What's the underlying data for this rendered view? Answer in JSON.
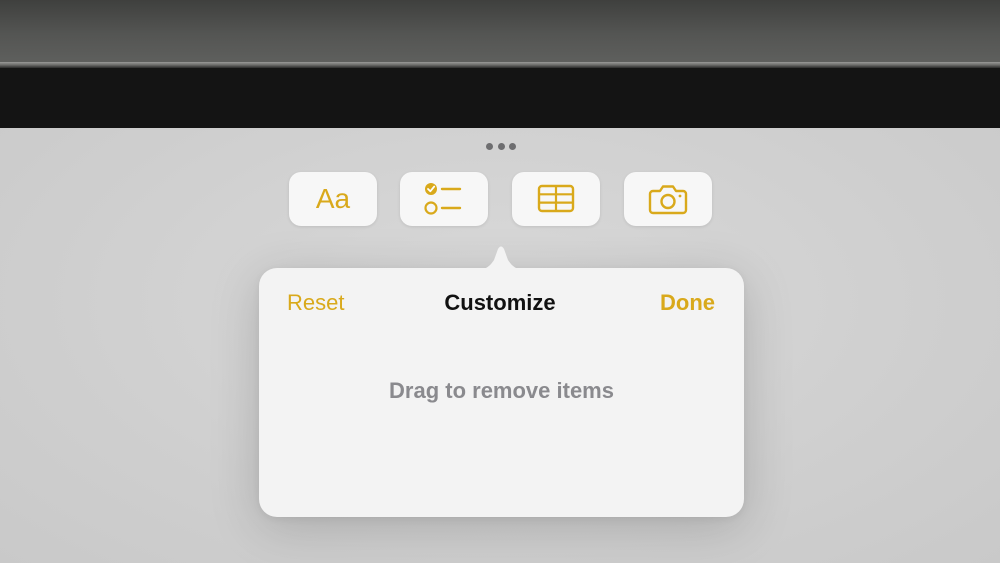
{
  "colors": {
    "accent": "#d9a91b",
    "background": "#d3d3d3",
    "popover": "#f3f3f3",
    "title": "#111111",
    "hint": "#8a8a8e"
  },
  "toolbar": {
    "more_icon": "ellipsis-icon",
    "items": [
      {
        "id": "format",
        "icon": "text-format-icon",
        "glyph": "Aa"
      },
      {
        "id": "checklist",
        "icon": "checklist-icon"
      },
      {
        "id": "table",
        "icon": "table-icon"
      },
      {
        "id": "camera",
        "icon": "camera-icon"
      }
    ]
  },
  "popover": {
    "reset_label": "Reset",
    "title": "Customize",
    "done_label": "Done",
    "hint": "Drag to remove items"
  }
}
